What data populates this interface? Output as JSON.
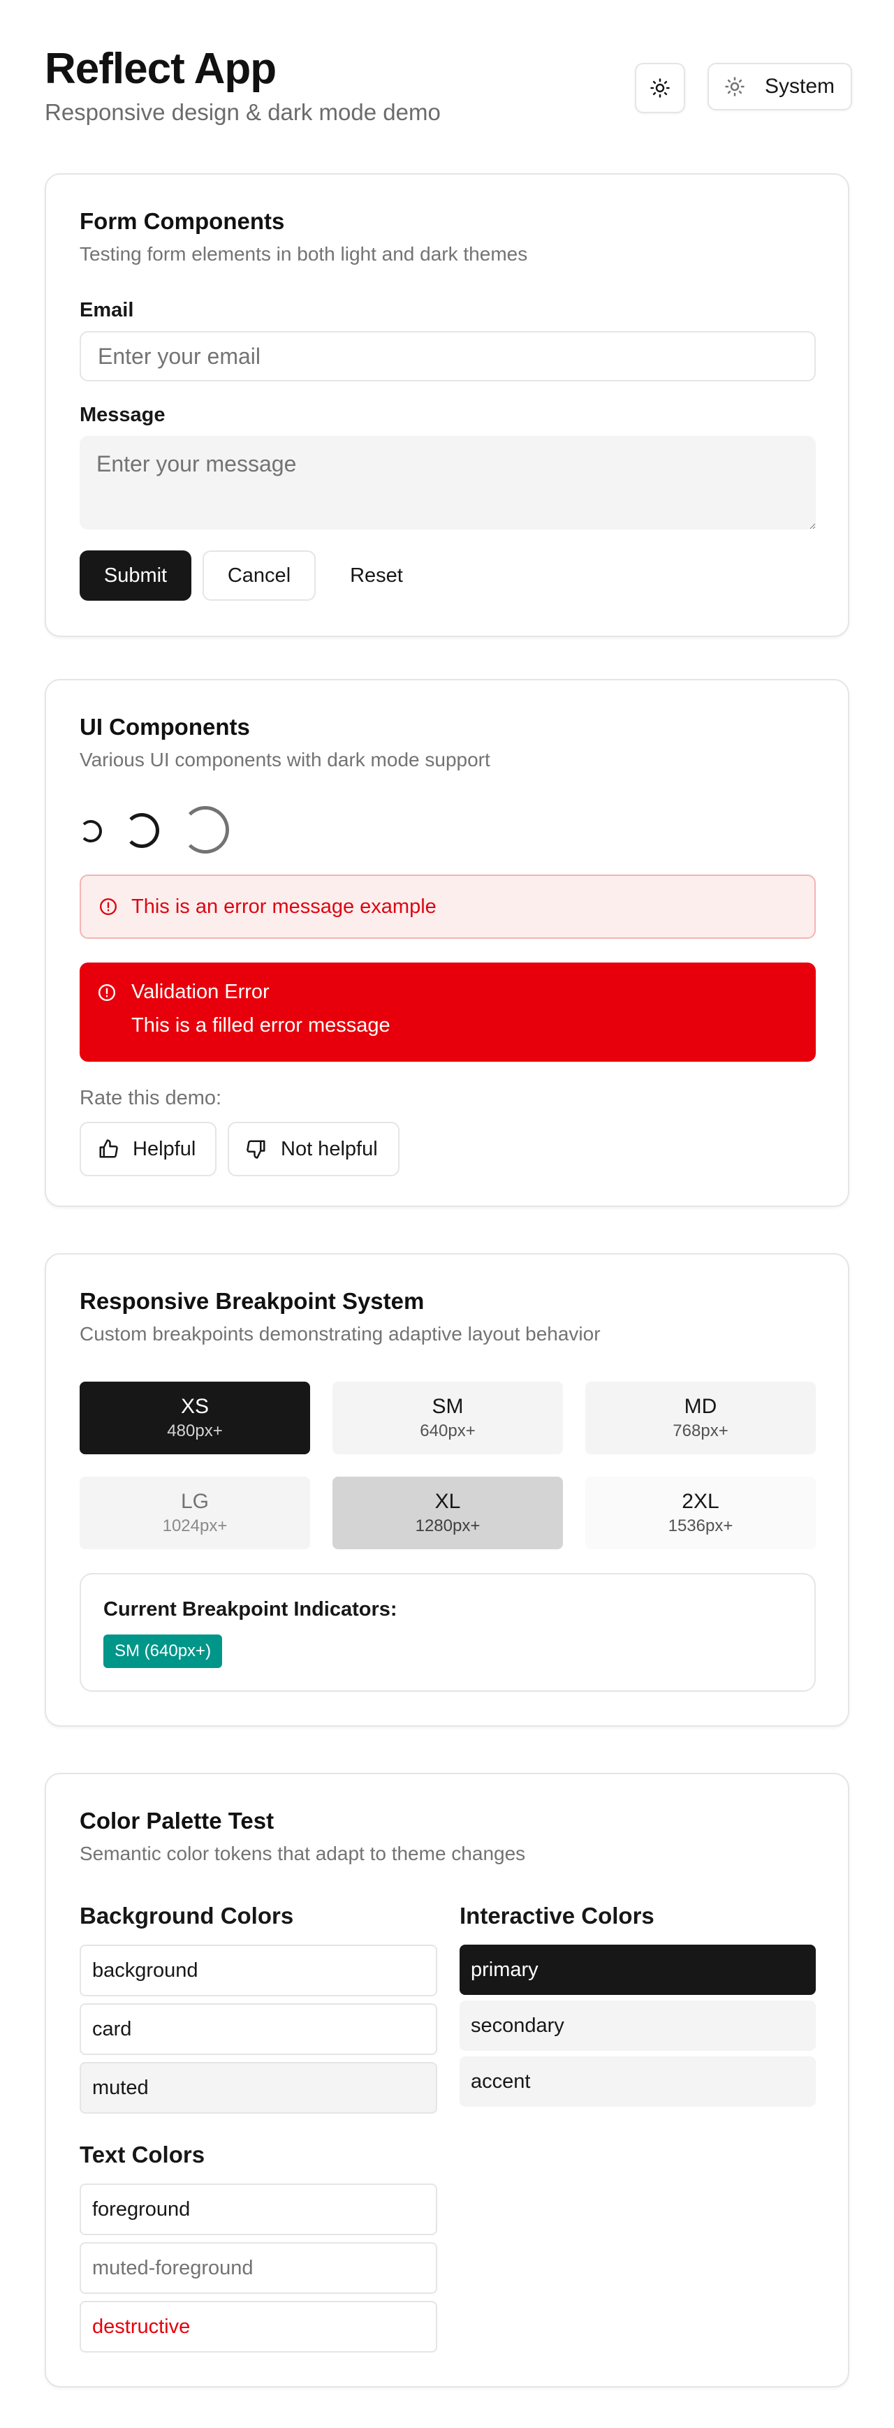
{
  "header": {
    "title": "Reflect App",
    "subtitle": "Responsive design & dark mode demo",
    "theme_icon": "sun-icon",
    "theme_select_label": "System"
  },
  "form_card": {
    "title": "Form Components",
    "description": "Testing form elements in both light and dark themes",
    "email_label": "Email",
    "email_placeholder": "Enter your email",
    "email_value": "",
    "message_label": "Message",
    "message_placeholder": "Enter your message",
    "message_value": "",
    "submit_label": "Submit",
    "cancel_label": "Cancel",
    "reset_label": "Reset"
  },
  "ui_card": {
    "title": "UI Components",
    "description": "Various UI components with dark mode support",
    "error_outline_text": "This is an error message example",
    "error_filled_title": "Validation Error",
    "error_filled_text": "This is a filled error message",
    "rate_label": "Rate this demo:",
    "helpful_label": "Helpful",
    "not_helpful_label": "Not helpful"
  },
  "breakpoint_card": {
    "title": "Responsive Breakpoint System",
    "description": "Custom breakpoints demonstrating adaptive layout behavior",
    "tiles": [
      {
        "name": "XS",
        "size": "480px+"
      },
      {
        "name": "SM",
        "size": "640px+"
      },
      {
        "name": "MD",
        "size": "768px+"
      },
      {
        "name": "LG",
        "size": "1024px+"
      },
      {
        "name": "XL",
        "size": "1280px+"
      },
      {
        "name": "2XL",
        "size": "1536px+"
      }
    ],
    "indicators_title": "Current Breakpoint Indicators:",
    "current_badge": "SM (640px+)"
  },
  "color_card": {
    "title": "Color Palette Test",
    "description": "Semantic color tokens that adapt to theme changes",
    "background_heading": "Background Colors",
    "background_items": [
      "background",
      "card",
      "muted"
    ],
    "interactive_heading": "Interactive Colors",
    "interactive_items": [
      "primary",
      "secondary",
      "accent"
    ],
    "text_heading": "Text Colors",
    "text_items": [
      "foreground",
      "muted-foreground",
      "destructive"
    ]
  },
  "colors": {
    "primary": "#171717",
    "muted": "#f4f4f4",
    "destructive": "#e7000b",
    "badge": "#009689",
    "muted_foreground": "#737373"
  }
}
